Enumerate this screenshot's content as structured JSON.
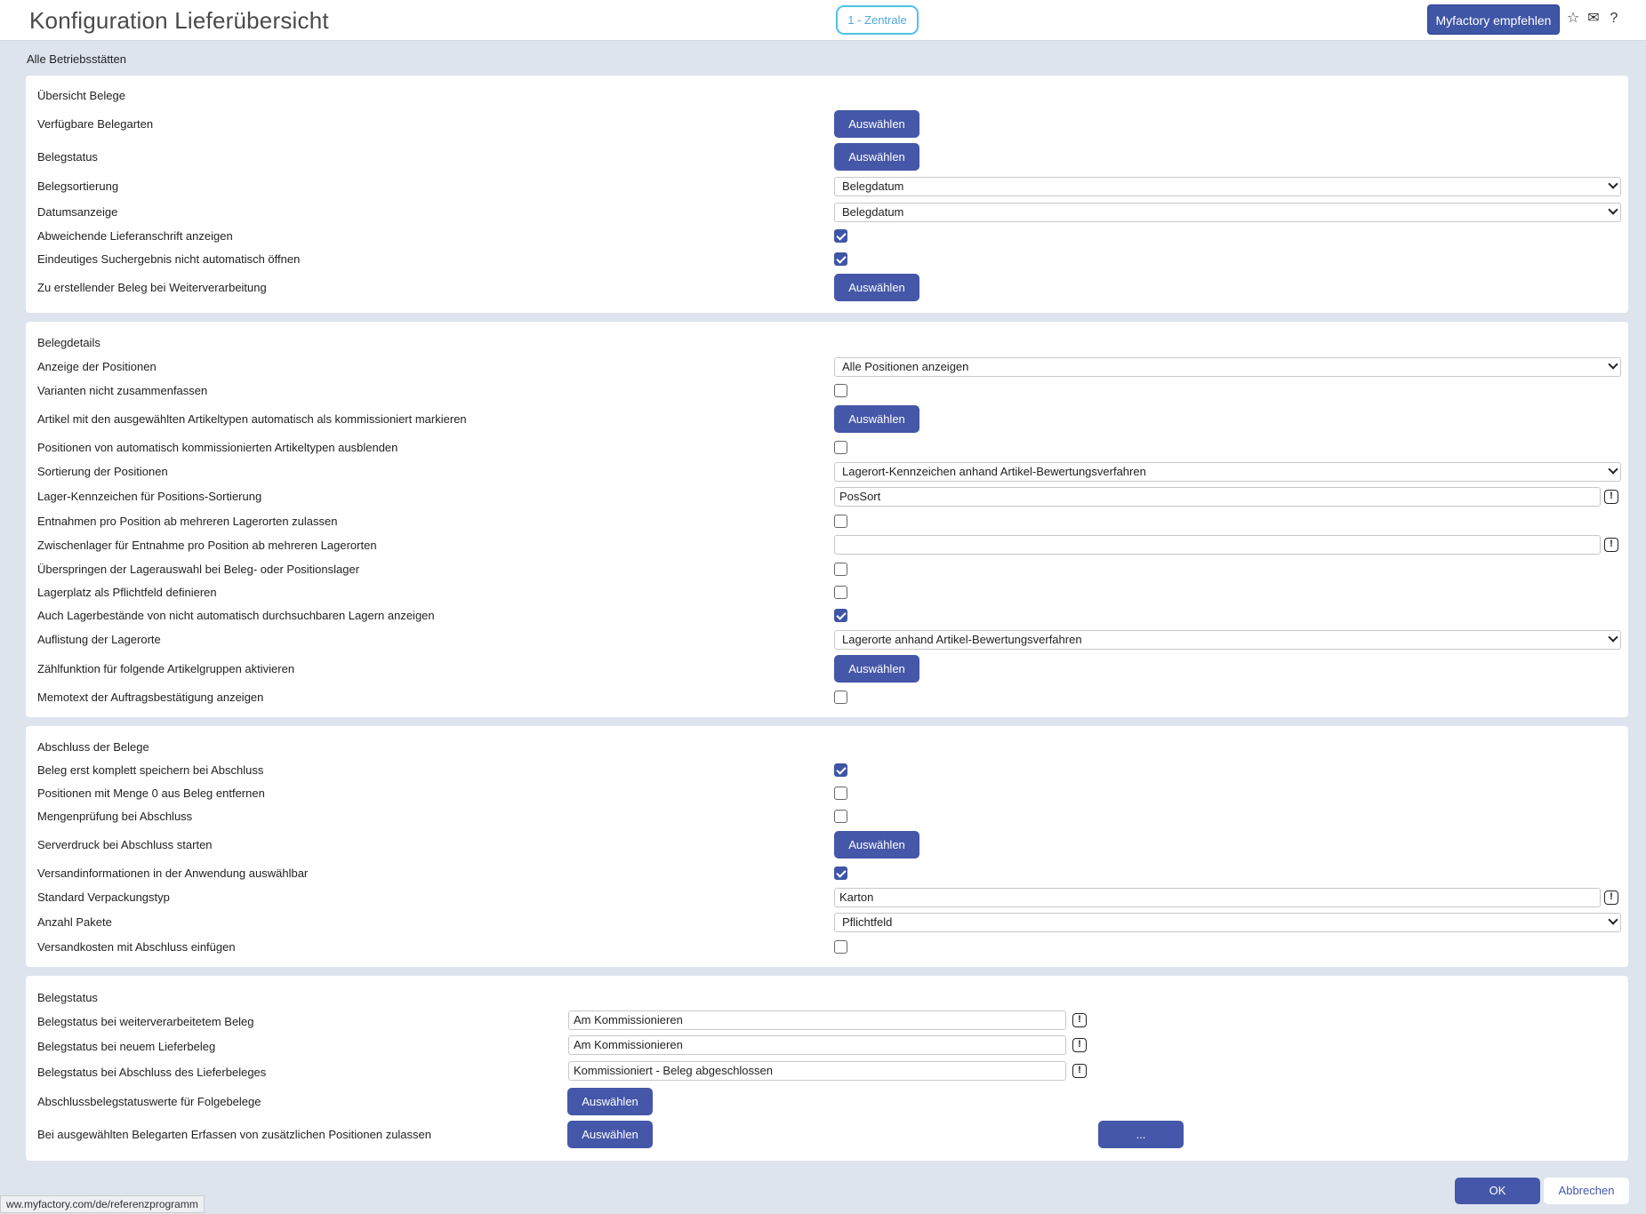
{
  "header": {
    "title": "Konfiguration Lieferübersicht",
    "tenant": "1 - Zentrale",
    "recommend": "Myfactory empfehlen",
    "icons": [
      "star-icon",
      "mail-icon",
      "help-icon"
    ]
  },
  "subtitle": "Alle Betriebsstätten",
  "sections": {
    "uebersicht": {
      "title": "Übersicht Belege",
      "rows": [
        {
          "label": "Verfügbare Belegarten",
          "type": "button",
          "value": "Auswählen"
        },
        {
          "label": "Belegstatus",
          "type": "button",
          "value": "Auswählen"
        },
        {
          "label": "Belegsortierung",
          "type": "select",
          "value": "Belegdatum"
        },
        {
          "label": "Datumsanzeige",
          "type": "select",
          "value": "Belegdatum"
        },
        {
          "label": "Abweichende Lieferanschrift anzeigen",
          "type": "checkbox",
          "checked": true
        },
        {
          "label": "Eindeutiges Suchergebnis nicht automatisch öffnen",
          "type": "checkbox",
          "checked": true
        },
        {
          "label": "Zu erstellender Beleg bei Weiterverarbeitung",
          "type": "button",
          "value": "Auswählen"
        }
      ]
    },
    "belegdetails": {
      "title": "Belegdetails",
      "rows": [
        {
          "label": "Anzeige der Positionen",
          "type": "select",
          "value": "Alle Positionen anzeigen"
        },
        {
          "label": "Varianten nicht zusammenfassen",
          "type": "checkbox",
          "checked": false
        },
        {
          "label": "Artikel mit den ausgewählten Artikeltypen automatisch als kommissioniert markieren",
          "type": "button",
          "value": "Auswählen"
        },
        {
          "label": "Positionen von automatisch kommissionierten Artikeltypen ausblenden",
          "type": "checkbox",
          "checked": false
        },
        {
          "label": "Sortierung der Positionen",
          "type": "select",
          "value": "Lagerort-Kennzeichen anhand Artikel-Bewertungsverfahren"
        },
        {
          "label": "Lager-Kennzeichen für Positions-Sortierung",
          "type": "input",
          "value": "PosSort"
        },
        {
          "label": "Entnahmen pro Position ab mehreren Lagerorten zulassen",
          "type": "checkbox",
          "checked": false
        },
        {
          "label": "Zwischenlager für Entnahme pro Position ab mehreren Lagerorten",
          "type": "input",
          "value": ""
        },
        {
          "label": "Überspringen der Lagerauswahl bei Beleg- oder Positionslager",
          "type": "checkbox",
          "checked": false
        },
        {
          "label": "Lagerplatz als Pflichtfeld definieren",
          "type": "checkbox",
          "checked": false
        },
        {
          "label": "Auch Lagerbestände von nicht automatisch durchsuchbaren Lagern anzeigen",
          "type": "checkbox",
          "checked": true
        },
        {
          "label": "Auflistung der Lagerorte",
          "type": "select",
          "value": "Lagerorte anhand Artikel-Bewertungsverfahren"
        },
        {
          "label": "Zählfunktion für folgende Artikelgruppen aktivieren",
          "type": "button",
          "value": "Auswählen"
        },
        {
          "label": "Memotext der Auftragsbestätigung anzeigen",
          "type": "checkbox",
          "checked": false
        }
      ]
    },
    "abschluss": {
      "title": "Abschluss der Belege",
      "rows": [
        {
          "label": "Beleg erst komplett speichern bei Abschluss",
          "type": "checkbox",
          "checked": true
        },
        {
          "label": "Positionen mit Menge 0 aus Beleg entfernen",
          "type": "checkbox",
          "checked": false
        },
        {
          "label": "Mengenprüfung bei Abschluss",
          "type": "checkbox",
          "checked": false
        },
        {
          "label": "Serverdruck bei Abschluss starten",
          "type": "button",
          "value": "Auswählen"
        },
        {
          "label": "Versandinformationen in der Anwendung auswählbar",
          "type": "checkbox",
          "checked": true
        },
        {
          "label": "Standard Verpackungstyp",
          "type": "input",
          "value": "Karton"
        },
        {
          "label": "Anzahl Pakete",
          "type": "select",
          "value": "Pflichtfeld"
        },
        {
          "label": "Versandkosten mit Abschluss einfügen",
          "type": "checkbox",
          "checked": false
        }
      ]
    },
    "belegstatus": {
      "title": "Belegstatus",
      "rows": [
        {
          "label": "Belegstatus bei weiterverarbeitetem Beleg",
          "type": "input",
          "value": "Am Kommissionieren"
        },
        {
          "label": "Belegstatus bei neuem Lieferbeleg",
          "type": "input",
          "value": "Am Kommissionieren"
        },
        {
          "label": "Belegstatus bei Abschluss des Lieferbeleges",
          "type": "input",
          "value": "Kommissioniert - Beleg abgeschlossen"
        },
        {
          "label": "Abschlussbelegstatuswerte für Folgebelege",
          "type": "button",
          "value": "Auswählen"
        },
        {
          "label": "Bei ausgewählten Belegarten Erfassen von zusätzlichen Positionen zulassen",
          "type": "button",
          "value": "Auswählen",
          "extra": "..."
        }
      ]
    }
  },
  "footer": {
    "ok": "OK",
    "cancel": "Abbrechen",
    "status_url": "ww.myfactory.com/de/referenzprogramm"
  }
}
